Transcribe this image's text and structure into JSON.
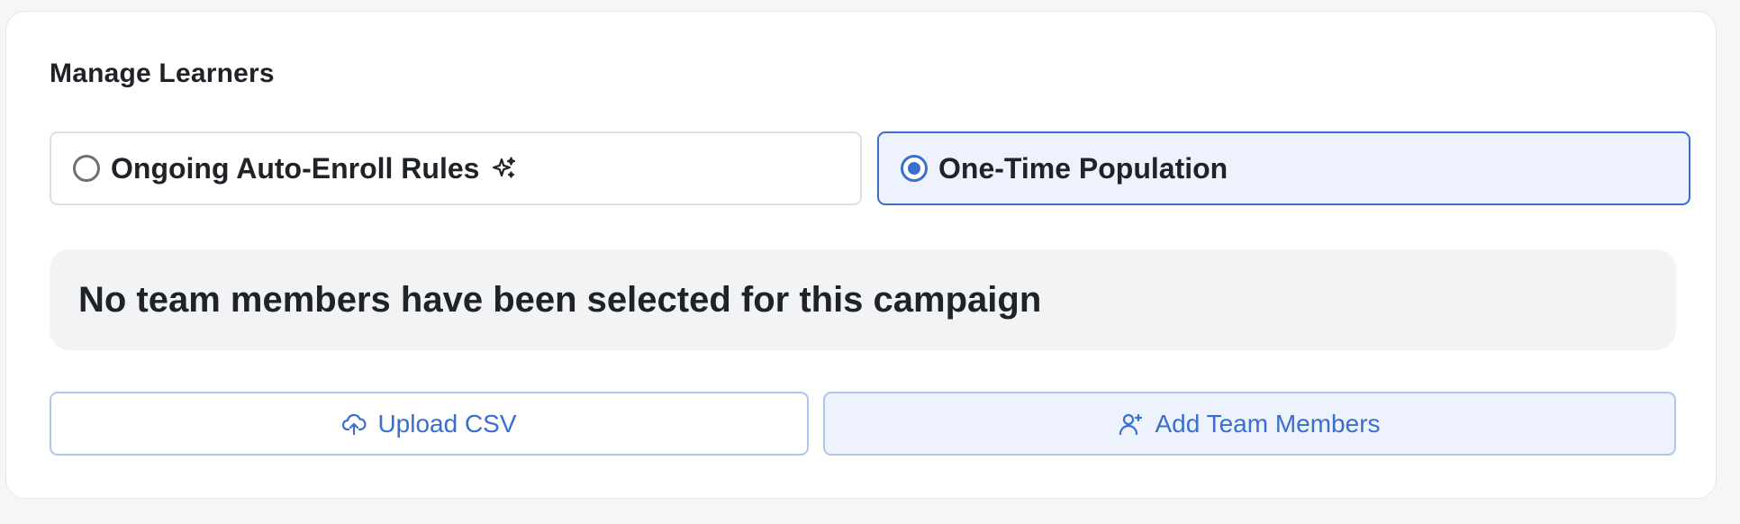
{
  "section": {
    "title": "Manage Learners"
  },
  "enrollment_options": [
    {
      "label": "Ongoing Auto-Enroll Rules",
      "selected": false,
      "icon": "sparkle-icon"
    },
    {
      "label": "One-Time Population",
      "selected": true
    }
  ],
  "empty_state": {
    "message": "No team members have been selected for this campaign"
  },
  "actions": {
    "upload_label": "Upload CSV",
    "upload_icon": "cloud-upload-icon",
    "add_label": "Add Team Members",
    "add_icon": "user-plus-icon"
  },
  "colors": {
    "accent": "#3a6fce",
    "selected_bg": "#edf2fc",
    "empty_bg": "#f2f3f5",
    "text": "#1f2328"
  }
}
